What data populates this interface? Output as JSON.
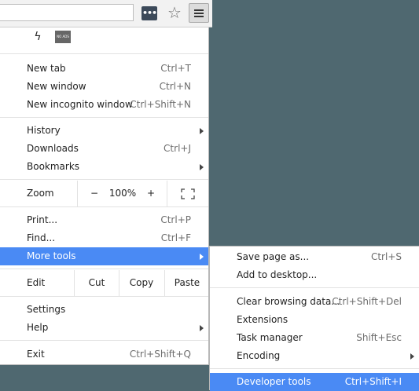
{
  "toolbar": {
    "ext_dots": "•••",
    "star_icon": "☆"
  },
  "menu": {
    "ext_row": {
      "bolt_icon": "ϟ",
      "noads_label": "NO ADS"
    },
    "group1": [
      {
        "label": "New tab",
        "shortcut": "Ctrl+T"
      },
      {
        "label": "New window",
        "shortcut": "Ctrl+N"
      },
      {
        "label": "New incognito window",
        "shortcut": "Ctrl+Shift+N"
      }
    ],
    "group2": [
      {
        "label": "History",
        "shortcut": ""
      },
      {
        "label": "Downloads",
        "shortcut": "Ctrl+J"
      },
      {
        "label": "Bookmarks",
        "shortcut": ""
      }
    ],
    "zoom": {
      "label": "Zoom",
      "minus": "−",
      "value": "100%",
      "plus": "+"
    },
    "group3": [
      {
        "label": "Print...",
        "shortcut": "Ctrl+P"
      },
      {
        "label": "Find...",
        "shortcut": "Ctrl+F"
      },
      {
        "label": "More tools",
        "shortcut": ""
      }
    ],
    "edit": {
      "label": "Edit",
      "cut": "Cut",
      "copy": "Copy",
      "paste": "Paste"
    },
    "group4": [
      {
        "label": "Settings",
        "shortcut": ""
      },
      {
        "label": "Help",
        "shortcut": ""
      }
    ],
    "exit": {
      "label": "Exit",
      "shortcut": "Ctrl+Shift+Q"
    }
  },
  "submenu": {
    "group1": [
      {
        "label": "Save page as...",
        "shortcut": "Ctrl+S"
      },
      {
        "label": "Add to desktop...",
        "shortcut": ""
      }
    ],
    "group2": [
      {
        "label": "Clear browsing data...",
        "shortcut": "Ctrl+Shift+Del"
      },
      {
        "label": "Extensions",
        "shortcut": ""
      },
      {
        "label": "Task manager",
        "shortcut": "Shift+Esc"
      },
      {
        "label": "Encoding",
        "shortcut": ""
      }
    ],
    "developer": {
      "label": "Developer tools",
      "shortcut": "Ctrl+Shift+I"
    }
  },
  "colors": {
    "highlight": "#4a8af4",
    "desktop": "#4f6870"
  }
}
